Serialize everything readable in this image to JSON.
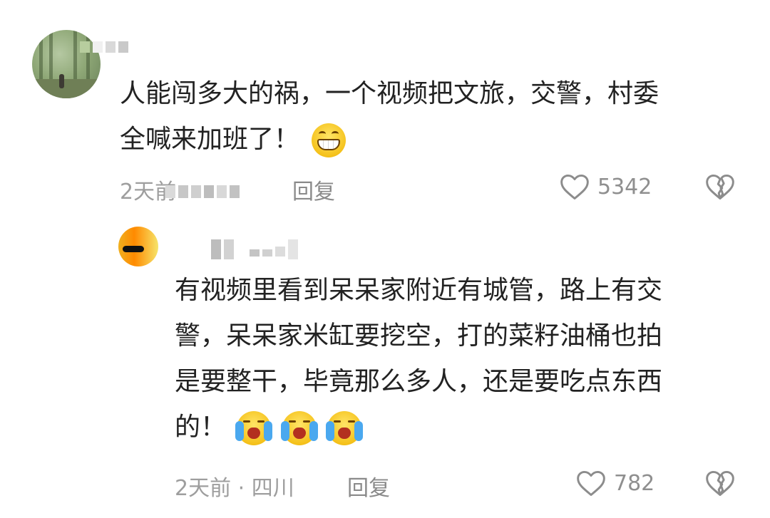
{
  "comments": [
    {
      "text_lines": [
        "人能闯多大的祸，一个视频把文旅，交警，村委",
        "全喊来加班了！"
      ],
      "emoji_icons": [
        "grinning-teeth-face-icon"
      ],
      "time": "2天前",
      "reply_label": "回复",
      "like_count": "5342"
    },
    {
      "text_lines": [
        "有视频里看到呆呆家附近有城管，路上有交",
        "警，呆呆家米缸要挖空，打的菜籽油桶也拍",
        "是要整干，毕竟那么多人，还是要吃点东西",
        "的！"
      ],
      "emoji_icons": [
        "crying-face-icon",
        "crying-face-icon",
        "crying-face-icon"
      ],
      "time_location": "2天前 · 四川",
      "reply_label": "回复",
      "like_count": "782"
    }
  ],
  "colors": {
    "text": "#222222",
    "meta": "#9e9e9e",
    "icon": "#8c8c8c"
  }
}
